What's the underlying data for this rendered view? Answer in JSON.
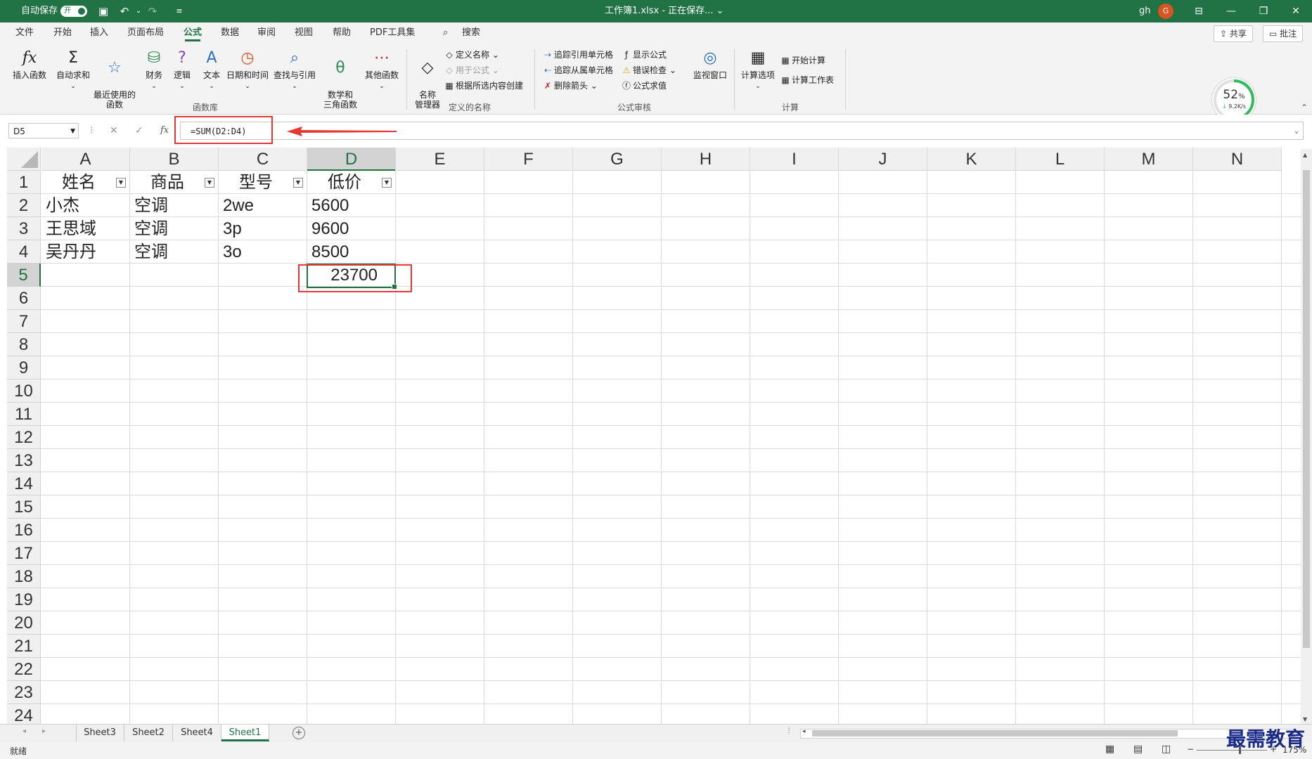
{
  "titlebar": {
    "autosave_label": "自动保存",
    "autosave_state": "开",
    "title": "工作簿1.xlsx - 正在保存... ⌄",
    "user": "gh",
    "avatar_initial": "G"
  },
  "menu": {
    "tabs": [
      "文件",
      "开始",
      "插入",
      "页面布局",
      "公式",
      "数据",
      "审阅",
      "视图",
      "帮助",
      "PDF工具集"
    ],
    "active_tab": "公式",
    "search": "搜索",
    "share": "共享",
    "comment": "批注"
  },
  "ribbon": {
    "function_library": {
      "insert_function": "插入函数",
      "autosum": "自动求和",
      "recent": "最近使用的\n函数",
      "financial": "财务",
      "logical": "逻辑",
      "text": "文本",
      "datetime": "日期和时间",
      "lookup": "查找与引用",
      "math": "数学和\n三角函数",
      "more": "其他函数",
      "group_label": "函数库"
    },
    "defined_names": {
      "name_manager": "名称\n管理器",
      "define_name": "定义名称",
      "use_in_formula": "用于公式",
      "create_from_selection": "根据所选内容创建",
      "group_label": "定义的名称"
    },
    "formula_auditing": {
      "trace_precedents": "追踪引用单元格",
      "trace_dependents": "追踪从属单元格",
      "remove_arrows": "删除箭头",
      "show_formulas": "显示公式",
      "error_checking": "错误检查",
      "evaluate_formula": "公式求值",
      "watch_window": "监视窗口",
      "group_label": "公式审核"
    },
    "calculation": {
      "options": "计算选项",
      "calc_now": "开始计算",
      "calc_sheet": "计算工作表",
      "group_label": "计算"
    }
  },
  "progress": {
    "percent": "52",
    "unit": "%",
    "speed": "9.2K/s"
  },
  "formula_bar": {
    "name_box": "D5",
    "fx": "fx",
    "formula": "=SUM(D2:D4)"
  },
  "grid": {
    "columns": [
      "A",
      "B",
      "C",
      "D",
      "E",
      "F",
      "G",
      "H",
      "I",
      "J",
      "K",
      "L",
      "M",
      "N"
    ],
    "selected_column": "D",
    "rows": [
      "1",
      "2",
      "3",
      "4",
      "5",
      "6",
      "7",
      "8",
      "9",
      "10",
      "11",
      "12",
      "13",
      "14",
      "15",
      "16",
      "17",
      "18",
      "19",
      "20",
      "21",
      "22",
      "23",
      "24"
    ],
    "selected_row": "5",
    "headers": [
      "姓名",
      "商品",
      "型号",
      "低价"
    ],
    "data": [
      [
        "小杰",
        "空调",
        "2we",
        "5600"
      ],
      [
        "王思域",
        "空调",
        "3p",
        "9600"
      ],
      [
        "吴丹丹",
        "空调",
        "3o",
        "8500"
      ]
    ],
    "total": "23700"
  },
  "sheets": {
    "tabs": [
      "Sheet3",
      "Sheet2",
      "Sheet4",
      "Sheet1"
    ],
    "active": "Sheet1"
  },
  "status": {
    "ready": "就绪",
    "zoom": "175%"
  },
  "watermark": "最需教育"
}
